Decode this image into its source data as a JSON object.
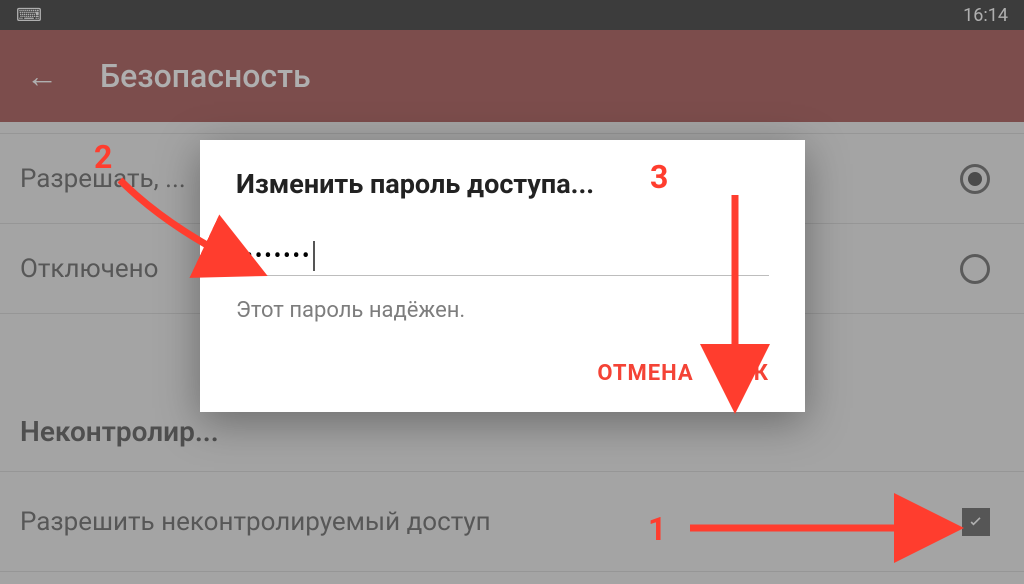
{
  "status_bar": {
    "keyboard_glyph": "⌨",
    "time": "16:14"
  },
  "app_bar": {
    "back_glyph": "←",
    "title": "Безопасность"
  },
  "background_list": {
    "option_allow_prompt": "Разрешать, ...",
    "option_disabled": "Отключено",
    "section_header": "Неконтролир...",
    "unsupervised_access": "Разрешить неконтролируемый доступ"
  },
  "dialog": {
    "title": "Изменить пароль доступа...",
    "password_masked": "••••••••",
    "hint": "Этот пароль надёжен.",
    "cancel": "ОТМЕНА",
    "ok": "ОК"
  },
  "annotations": {
    "label1": "1",
    "label2": "2",
    "label3": "3"
  }
}
